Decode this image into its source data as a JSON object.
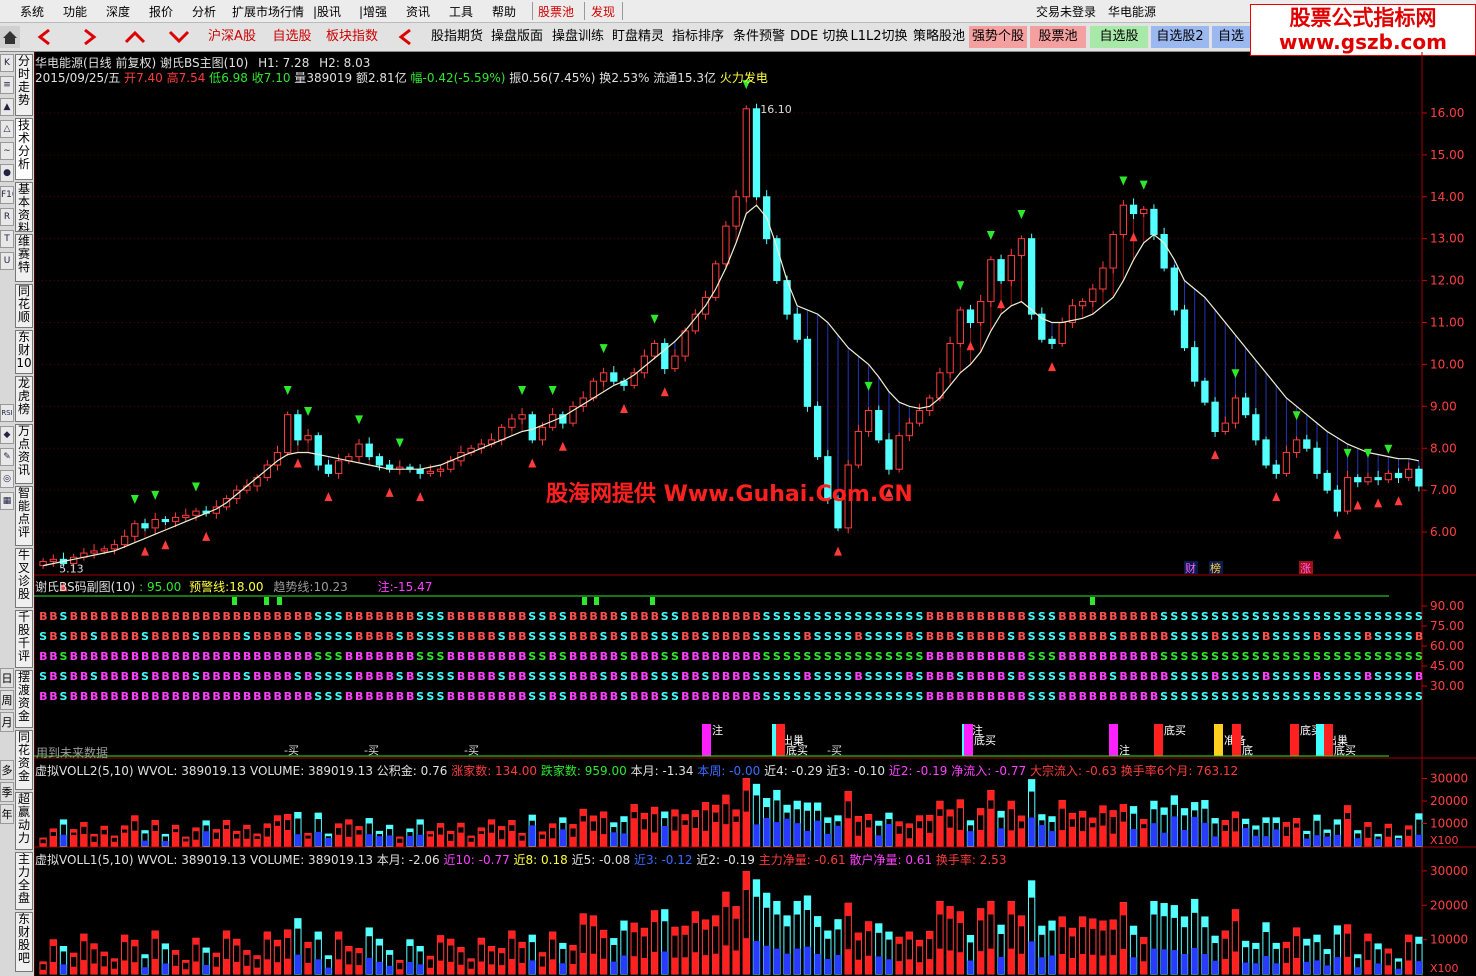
{
  "menu": {
    "items": [
      "系统",
      "功能",
      "深度",
      "报价",
      "分析",
      "扩展市场行情",
      "|股讯",
      "|增强",
      "资讯",
      "工具",
      "帮助",
      "股票池",
      "发现"
    ],
    "login_status": "交易未登录",
    "stock_name": "华电能源"
  },
  "toolbar": {
    "buttons": [
      "沪深A股",
      "自选股",
      "板块指数",
      "股指期货",
      "操盘版面",
      "操盘训练",
      "盯盘精灵",
      "指标排序",
      "条件预警",
      "DDE 切换",
      "L1L2切换",
      "策略股池",
      "强势个股",
      "股票池",
      "自选股",
      "自选股2",
      "自选"
    ]
  },
  "watermark": {
    "line1": "股票公式指标网",
    "line2": "www.gszb.com"
  },
  "sidebar": {
    "vertical_tabs": [
      "分时走势",
      "技术分析",
      "基本资料",
      "维赛特",
      "同花顺",
      "东财10",
      "龙虎榜",
      "万点资讯",
      "智能点评",
      "牛叉诊股",
      "千股千评",
      "摆渡资金",
      "同花资金",
      "超赢动力",
      "主力全盘",
      "东财股吧"
    ],
    "period_tabs": [
      "日",
      "周",
      "月",
      "多",
      "季",
      "年"
    ],
    "icons": [
      "K",
      "≡",
      "▲",
      "△",
      "∼",
      "●",
      "F10",
      "R",
      "T",
      "U",
      "RSI",
      "◆",
      "✎",
      "◎",
      "▦"
    ]
  },
  "main_chart": {
    "title": "华电能源(日线 前复权) 谢氏BS主图(10)",
    "h1": "H1: 7.28",
    "h2": "H2: 8.03",
    "date": "2015/09/25/五",
    "open_label": "开",
    "open": "7.40",
    "high_label": "高",
    "high": "7.54",
    "low_label": "低",
    "low": "6.98",
    "close_label": "收",
    "close": "7.10",
    "vol_label": "量",
    "vol": "389019",
    "amount_label": "额",
    "amount": "2.81亿",
    "chg_label": "幅",
    "chg": "-0.42(-5.59%)",
    "amp_label": "振",
    "amp": "0.56(7.45%)",
    "turn_label": "换",
    "turn": "2.53%",
    "float_label": "流通",
    "float": "15.3亿",
    "concept": "火力发电",
    "max_label": "16.10",
    "min_label": "5.13",
    "y_ticks": [
      "16.00",
      "15.00",
      "14.00",
      "13.00",
      "12.00",
      "11.00",
      "10.00",
      "9.00",
      "8.00",
      "7.00",
      "6.00"
    ],
    "flags": [
      "财",
      "榜",
      "涨"
    ],
    "center_watermark": "股海网提供 Www.Guhai.Com.CN"
  },
  "sub1": {
    "title": "谢氏BS码副图(10)",
    "v1": ": 95.00",
    "warn_label": "预警线:",
    "warn": "18.00",
    "trend_label": "趋势线:",
    "trend": "10.23",
    "note_label": "注:",
    "note": "-15.47",
    "y_ticks": [
      "90.00",
      "75.00",
      "60.00",
      "45.00",
      "30.00"
    ],
    "bottom_note": "用到未来数据",
    "tags": [
      "注",
      "出巢",
      "底买",
      "注",
      "底买",
      "注",
      "底买",
      "准备",
      "底",
      "底买",
      "出巢",
      "底买"
    ],
    "buy_marks": [
      "-买",
      "-买",
      "-买",
      "-买"
    ]
  },
  "sub2": {
    "title": "虚拟VOLL2(5,10)",
    "wvol": "WVOL: 389019.13",
    "volume": "VOLUME: 389019.13",
    "gjj": "公积金: 0.76",
    "up_cnt": "涨家数: 134.00",
    "down_cnt": "跌家数: 959.00",
    "month": "本月: -1.34",
    "week": "本周: -0.00",
    "n4": "近4: -0.29",
    "n3": "近3: -0.10",
    "n2": "近2: -0.19",
    "net_in": "净流入: -0.77",
    "big_in": "大宗流入: -0.63",
    "turn6": "换手率6个月: 763.12",
    "y_ticks": [
      "30000",
      "20000",
      "10000"
    ],
    "unit": "X100"
  },
  "sub3": {
    "title": "虚拟VOLL1(5,10)",
    "wvol": "WVOL: 389019.13",
    "volume": "VOLUME: 389019.13",
    "month": "本月: -2.06",
    "n10": "近10: -0.77",
    "n8": "近8: 0.18",
    "n5": "近5: -0.08",
    "n3": "近3: -0.12",
    "n2": "近2: -0.19",
    "main_net": "主力净量: -0.61",
    "retail_net": "散户净量: 0.61",
    "turn": "换手率: 2.53",
    "y_ticks": [
      "30000",
      "20000",
      "10000"
    ],
    "unit": "X100"
  },
  "colors": {
    "up": "#ff3c3c",
    "down": "#54ffff",
    "ma": "#f0f0d0",
    "blue_fill": "#1c2a9a",
    "grid": "#8b0000"
  },
  "chart_data": {
    "type": "candlestick",
    "title": "华电能源(日线 前复权)",
    "y_range": [
      5.0,
      16.5
    ],
    "close": [
      5.3,
      5.35,
      5.25,
      5.4,
      5.5,
      5.55,
      5.6,
      5.7,
      5.9,
      6.2,
      6.1,
      6.3,
      6.25,
      6.35,
      6.4,
      6.5,
      6.45,
      6.6,
      6.8,
      7.0,
      7.1,
      7.3,
      7.6,
      7.9,
      8.8,
      8.2,
      8.3,
      7.6,
      7.4,
      7.7,
      7.8,
      8.1,
      7.8,
      7.6,
      7.5,
      7.55,
      7.5,
      7.4,
      7.45,
      7.5,
      7.7,
      7.9,
      8.0,
      8.1,
      8.2,
      8.5,
      8.7,
      8.8,
      8.2,
      8.5,
      8.8,
      8.6,
      9.0,
      9.2,
      9.6,
      9.8,
      9.6,
      9.5,
      9.8,
      10.2,
      10.5,
      9.9,
      10.2,
      10.8,
      11.2,
      11.6,
      12.4,
      13.3,
      14.0,
      16.1,
      14.0,
      13.0,
      12.0,
      11.2,
      10.6,
      9.0,
      7.8,
      6.8,
      6.1,
      7.6,
      8.4,
      8.9,
      8.2,
      7.5,
      8.3,
      8.6,
      8.9,
      9.2,
      9.8,
      10.5,
      11.3,
      11.0,
      11.5,
      12.5,
      12.0,
      12.6,
      13.0,
      11.2,
      10.6,
      10.5,
      11.0,
      11.4,
      11.5,
      11.8,
      12.3,
      13.1,
      13.8,
      13.6,
      13.7,
      13.1,
      12.3,
      11.3,
      10.4,
      9.6,
      9.1,
      8.4,
      8.6,
      9.2,
      8.8,
      8.2,
      7.6,
      7.4,
      7.9,
      8.2,
      8.0,
      7.4,
      7.0,
      6.5,
      7.3,
      7.2,
      7.3,
      7.25,
      7.4,
      7.3,
      7.5,
      7.1
    ],
    "ma": [
      5.2,
      5.25,
      5.3,
      5.35,
      5.4,
      5.45,
      5.5,
      5.55,
      5.65,
      5.75,
      5.85,
      5.95,
      6.05,
      6.15,
      6.25,
      6.35,
      6.45,
      6.55,
      6.7,
      6.9,
      7.1,
      7.3,
      7.5,
      7.7,
      7.85,
      7.9,
      7.9,
      7.85,
      7.8,
      7.75,
      7.7,
      7.65,
      7.6,
      7.55,
      7.5,
      7.5,
      7.5,
      7.5,
      7.55,
      7.6,
      7.7,
      7.8,
      7.9,
      8.0,
      8.1,
      8.2,
      8.3,
      8.4,
      8.45,
      8.55,
      8.65,
      8.75,
      8.9,
      9.05,
      9.2,
      9.35,
      9.5,
      9.6,
      9.75,
      9.95,
      10.15,
      10.35,
      10.55,
      10.8,
      11.1,
      11.4,
      11.8,
      12.3,
      12.9,
      13.6,
      13.8,
      13.5,
      12.8,
      12.0,
      11.4,
      11.3,
      11.2,
      11.0,
      10.7,
      10.4,
      10.2,
      10.0,
      9.7,
      9.35,
      9.1,
      9.0,
      8.95,
      9.0,
      9.2,
      9.5,
      9.8,
      10.0,
      10.3,
      10.8,
      11.2,
      11.4,
      11.5,
      11.3,
      11.1,
      11.0,
      11.0,
      11.05,
      11.1,
      11.2,
      11.4,
      11.6,
      12.0,
      12.5,
      12.9,
      13.1,
      12.9,
      12.5,
      12.0,
      11.8,
      11.6,
      11.3,
      11.0,
      10.7,
      10.4,
      10.1,
      9.8,
      9.5,
      9.2,
      9.0,
      8.8,
      8.6,
      8.4,
      8.25,
      8.1,
      8.0,
      7.9,
      7.85,
      7.8,
      7.75,
      7.75,
      7.7
    ]
  }
}
